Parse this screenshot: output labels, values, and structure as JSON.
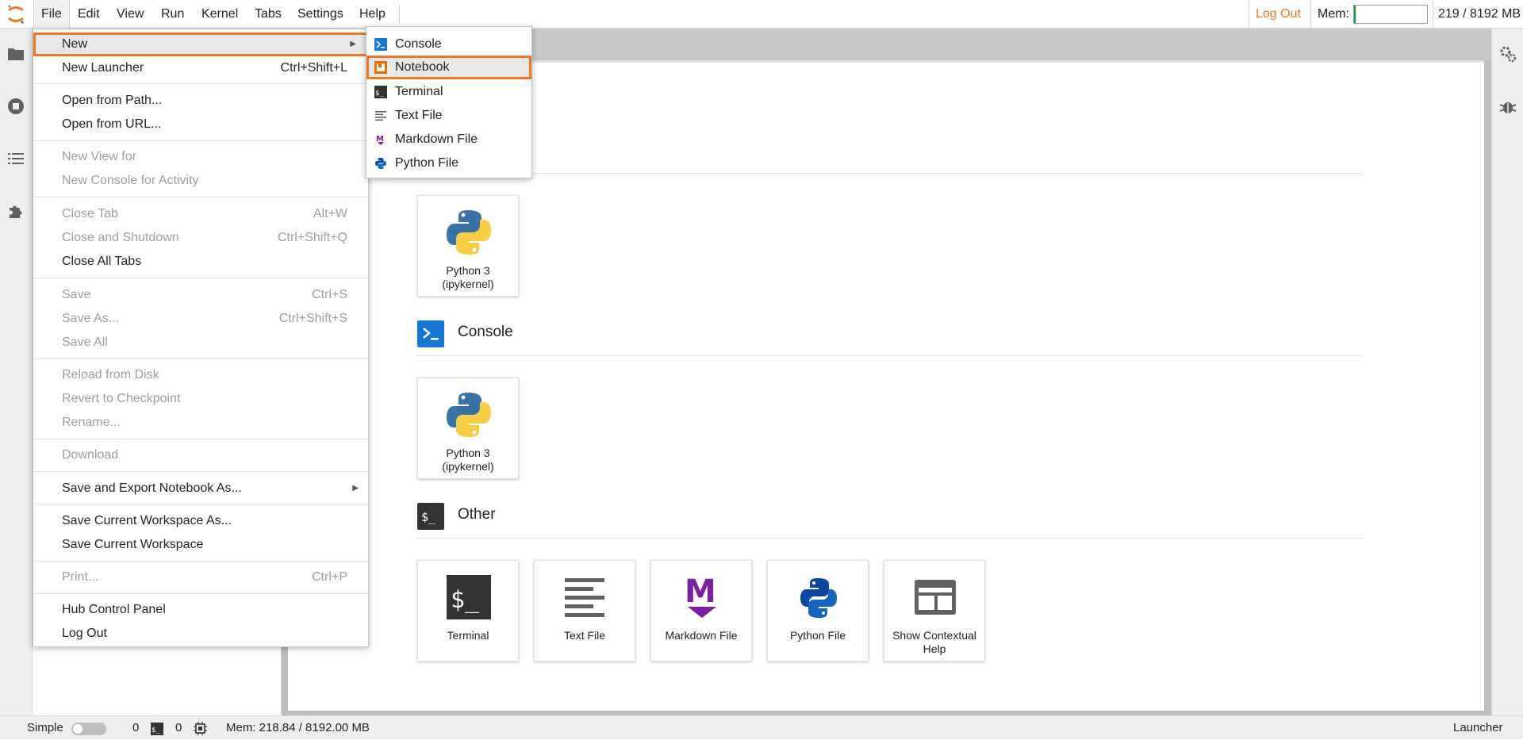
{
  "menubar": {
    "items": [
      "File",
      "Edit",
      "View",
      "Run",
      "Kernel",
      "Tabs",
      "Settings",
      "Help"
    ],
    "logout": "Log Out",
    "mem_label": "Mem:",
    "mem_value": "219 / 8192 MB",
    "mem_fraction": 0.027
  },
  "file_menu": {
    "new": "New",
    "new_launcher": "New Launcher",
    "new_launcher_sc": "Ctrl+Shift+L",
    "open_path": "Open from Path...",
    "open_url": "Open from URL...",
    "new_view": "New View for",
    "new_console_activity": "New Console for Activity",
    "close_tab": "Close Tab",
    "close_tab_sc": "Alt+W",
    "close_shutdown": "Close and Shutdown",
    "close_shutdown_sc": "Ctrl+Shift+Q",
    "close_all": "Close All Tabs",
    "save": "Save",
    "save_sc": "Ctrl+S",
    "save_as": "Save As...",
    "save_as_sc": "Ctrl+Shift+S",
    "save_all": "Save All",
    "reload": "Reload from Disk",
    "revert": "Revert to Checkpoint",
    "rename": "Rename...",
    "download": "Download",
    "save_export": "Save and Export Notebook As...",
    "save_workspace_as": "Save Current Workspace As...",
    "save_workspace": "Save Current Workspace",
    "print": "Print...",
    "print_sc": "Ctrl+P",
    "hub": "Hub Control Panel",
    "logout": "Log Out"
  },
  "new_submenu": {
    "console": "Console",
    "notebook": "Notebook",
    "terminal": "Terminal",
    "text_file": "Text File",
    "markdown_file": "Markdown File",
    "python_file": "Python File"
  },
  "launcher": {
    "notebook_card": "Python 3 (ipykernel)",
    "console_section": "Console",
    "console_card": "Python 3 (ipykernel)",
    "other_section": "Other",
    "other_cards": {
      "terminal": "Terminal",
      "text_file": "Text File",
      "markdown_file": "Markdown File",
      "python_file": "Python File",
      "contextual_help": "Show Contextual Help"
    }
  },
  "statusbar": {
    "simple": "Simple",
    "kernels_count": "0",
    "terminals_count": "0",
    "mem": "Mem: 218.84 / 8192.00 MB",
    "mode": "Launcher"
  },
  "colors": {
    "accent": "#f37626",
    "console_blue": "#1976d2",
    "markdown_purple": "#7b1fa2",
    "terminal_dark": "#333333"
  }
}
